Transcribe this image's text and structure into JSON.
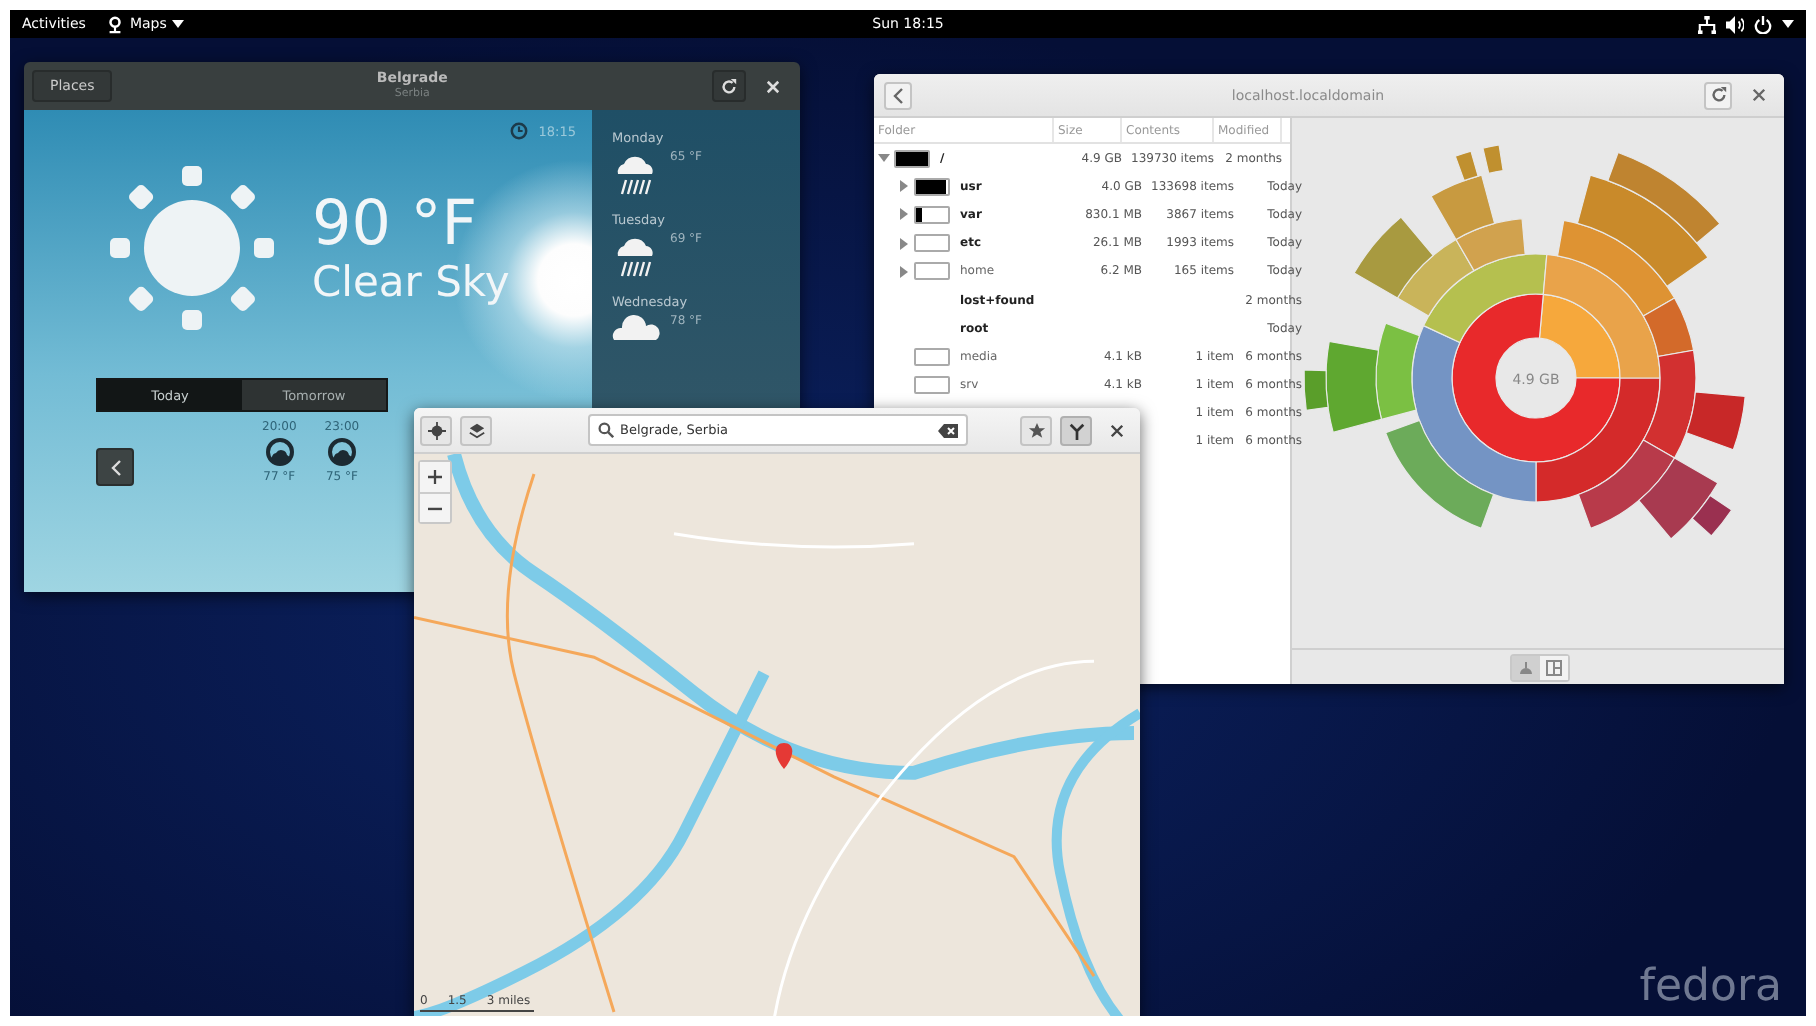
{
  "top_bar": {
    "activities": "Activities",
    "app_menu": "Maps",
    "clock": "Sun 18:15"
  },
  "weather": {
    "places_button": "Places",
    "title": "Belgrade",
    "subtitle": "Serbia",
    "update_time": "18:15",
    "temperature": "90 °F",
    "condition": "Clear Sky",
    "tabs": [
      {
        "label": "Today",
        "selected": true
      },
      {
        "label": "Tomorrow",
        "selected": false
      }
    ],
    "hourly": [
      {
        "time": "20:00",
        "temperature": "77 °F"
      },
      {
        "time": "23:00",
        "temperature": "75 °F"
      }
    ],
    "forecast": [
      {
        "day": "Monday",
        "temperature": "65 °F",
        "kind": "rain"
      },
      {
        "day": "Tuesday",
        "temperature": "69 °F",
        "kind": "rain"
      },
      {
        "day": "Wednesday",
        "temperature": "78 °F",
        "kind": "cloud"
      }
    ]
  },
  "disk_usage": {
    "title": "localhost.localdomain",
    "columns": [
      "Folder",
      "Size",
      "Contents",
      "Modified"
    ],
    "rows": [
      {
        "name": "/",
        "size": "4.9 GB",
        "contents": "139730 items",
        "modified": "2 months",
        "bold": true,
        "expandable": true,
        "expanded": true,
        "level": 1,
        "children": [
          {
            "name": "usr",
            "size": "4.0 GB",
            "contents": "133698 items",
            "modified": "Today",
            "bold": true,
            "expandable": true,
            "expanded": false,
            "level": 0.95
          },
          {
            "name": "var",
            "size": "830.1 MB",
            "contents": "3867 items",
            "modified": "Today",
            "bold": true,
            "expandable": true,
            "expanded": false,
            "level": 0.18
          },
          {
            "name": "etc",
            "size": "26.1 MB",
            "contents": "1993 items",
            "modified": "Today",
            "bold": true,
            "expandable": true,
            "expanded": false,
            "level": 0
          },
          {
            "name": "home",
            "size": "6.2 MB",
            "contents": "165 items",
            "modified": "Today",
            "bold": false,
            "expandable": true,
            "expanded": false,
            "level": 0
          },
          {
            "name": "lost+found",
            "modified": "2 months",
            "bold": true,
            "expandable": false
          },
          {
            "name": "root",
            "modified": "Today",
            "bold": true,
            "expandable": false
          },
          {
            "name": "media",
            "size": "4.1 kB",
            "contents": "1 item",
            "modified": "6 months",
            "bold": false,
            "expandable": false,
            "level": 0
          },
          {
            "name": "srv",
            "size": "4.1 kB",
            "contents": "1 item",
            "modified": "6 months",
            "bold": false,
            "expandable": false,
            "level": 0
          },
          {
            "contents": "1 item",
            "modified": "6 months",
            "expandable": false
          },
          {
            "contents": "1 item",
            "modified": "6 months",
            "expandable": false
          }
        ]
      }
    ],
    "chart_center_label": "4.9 GB",
    "view_buttons": [
      {
        "kind": "rings",
        "selected": true
      },
      {
        "kind": "treemap",
        "selected": false
      }
    ]
  },
  "maps": {
    "search": {
      "value": "Belgrade, Serbia"
    },
    "route_button": {
      "selected": true
    },
    "scale": [
      "0",
      "1.5",
      "3 miles"
    ]
  },
  "wallpaper": {
    "logo": "fedora"
  }
}
